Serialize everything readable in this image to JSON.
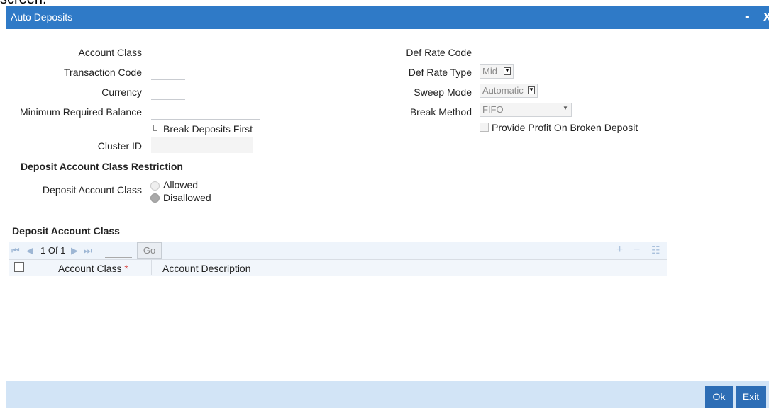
{
  "page_top_text": "screen.",
  "window": {
    "title": "Auto Deposits",
    "minimize_glyph": "-",
    "close_glyph": "x"
  },
  "form": {
    "account_class_label": "Account Class",
    "transaction_code_label": "Transaction Code",
    "currency_label": "Currency",
    "min_balance_label": "Minimum Required Balance",
    "break_deposits_first_label": "Break Deposits First",
    "cluster_id_label": "Cluster ID",
    "def_rate_code_label": "Def Rate Code",
    "def_rate_type_label": "Def Rate Type",
    "def_rate_type_value": "Mid",
    "sweep_mode_label": "Sweep Mode",
    "sweep_mode_value": "Automatic",
    "break_method_label": "Break Method",
    "break_method_value": "FIFO",
    "provide_profit_label": "Provide Profit On Broken Deposit"
  },
  "restriction": {
    "header": "Deposit Account Class Restriction",
    "label": "Deposit Account Class",
    "allowed": "Allowed",
    "disallowed": "Disallowed",
    "selected": "Disallowed"
  },
  "grid": {
    "header": "Deposit Account Class",
    "page_text": "1 Of 1",
    "go_label": "Go",
    "col_account_class": "Account Class",
    "required_marker": "*",
    "col_account_description": "Account Description",
    "rows": []
  },
  "footer": {
    "ok_label": "Ok",
    "exit_label": "Exit"
  },
  "colors": {
    "title_bar": "#2f7ac7",
    "footer": "#d2e4f6",
    "button": "#2d6db5",
    "required": "#d9534f"
  }
}
